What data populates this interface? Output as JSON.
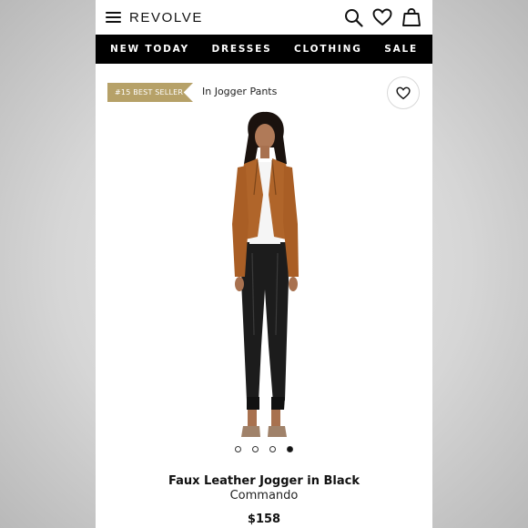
{
  "header": {
    "logo": "REVOLVE",
    "icons": [
      "menu-icon",
      "search-icon",
      "heart-icon",
      "bag-icon"
    ]
  },
  "nav": {
    "items": [
      {
        "label": "NEW TODAY"
      },
      {
        "label": "DRESSES"
      },
      {
        "label": "CLOTHING"
      },
      {
        "label": "SALE"
      }
    ]
  },
  "badge": {
    "label": "#15 BEST SELLER",
    "category": "In Jogger Pants",
    "color": "#b6a168"
  },
  "gallery": {
    "image_count": 4,
    "active_index": 3
  },
  "product": {
    "name": "Faux Leather Jogger in Black",
    "brand": "Commando",
    "price": "$158"
  },
  "colors": {
    "nav_bg": "#000000",
    "jacket": "#b0652a",
    "pants": "#1c1c1c"
  }
}
